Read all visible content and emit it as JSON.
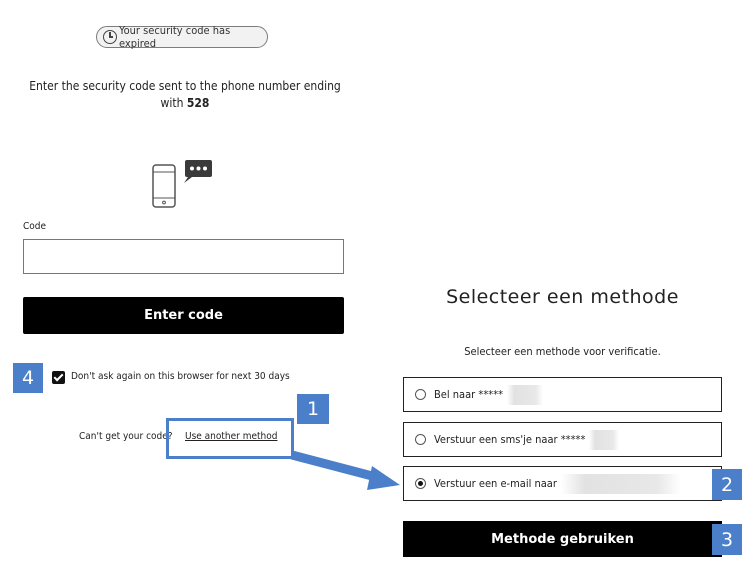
{
  "left": {
    "expired_text": "Your security code has expired",
    "instruction_prefix": "Enter the security code sent to the phone number ending with",
    "phone_suffix": "528",
    "code_label": "Code",
    "code_value": "",
    "enter_button": "Enter code",
    "remember_label": "Don't ask again on this browser for next 30 days",
    "remember_checked": true,
    "cant_get_text": "Can't get your code?",
    "another_method_link": "Use another method"
  },
  "right": {
    "title": "Selecteer een methode",
    "subtitle": "Selecteer een methode voor verificatie.",
    "options": [
      {
        "label": "Bel naar *****",
        "selected": false
      },
      {
        "label": "Verstuur een sms'je naar *****",
        "selected": false
      },
      {
        "label": "Verstuur een e-mail naar",
        "selected": true
      }
    ],
    "submit_button": "Methode gebruiken"
  },
  "annotations": {
    "badges": [
      "1",
      "2",
      "3",
      "4"
    ],
    "accent_color": "#4b7fc9"
  }
}
